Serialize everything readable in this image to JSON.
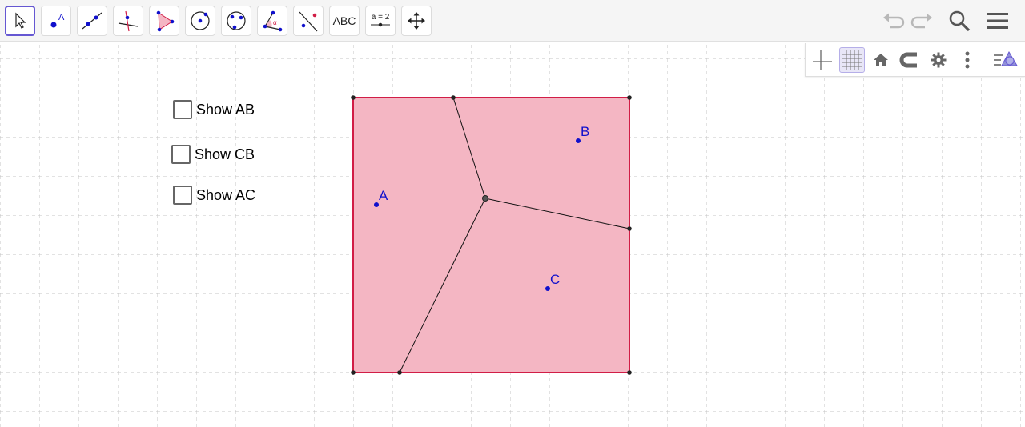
{
  "toolbar": {
    "tools": [
      {
        "name": "move-tool",
        "selected": true
      },
      {
        "name": "point-tool",
        "point_label": "A"
      },
      {
        "name": "line-tool"
      },
      {
        "name": "perpendicular-line-tool"
      },
      {
        "name": "polygon-tool"
      },
      {
        "name": "circle-center-point-tool"
      },
      {
        "name": "circle-three-points-tool"
      },
      {
        "name": "angle-tool",
        "angle_label": "α"
      },
      {
        "name": "reflect-tool"
      },
      {
        "name": "text-tool",
        "label": "ABC"
      },
      {
        "name": "slider-tool",
        "label": "a = 2"
      },
      {
        "name": "move-graphics-view-tool"
      }
    ]
  },
  "checkboxes": [
    {
      "label": "Show AB",
      "checked": false
    },
    {
      "label": "Show CB",
      "checked": false
    },
    {
      "label": "Show AC",
      "checked": false
    }
  ],
  "points": {
    "A": "A",
    "B": "B",
    "C": "C"
  },
  "colors": {
    "accent": "#6557d2",
    "polygon_fill": "#f4b6c3",
    "polygon_stroke": "#d11d46",
    "point_blue": "#1010cc",
    "grid": "#c0c0c0"
  },
  "style_bar": {
    "buttons": [
      "axes-icon",
      "grid-icon",
      "home-icon",
      "magnet-icon",
      "gear-icon",
      "more-vert-icon",
      "algebra-view-icon"
    ]
  }
}
